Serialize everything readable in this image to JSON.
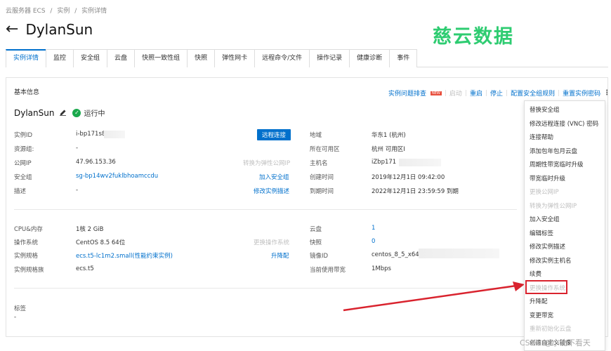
{
  "breadcrumb": [
    "云服务器 ECS",
    "/",
    "实例",
    "/",
    "实例详情"
  ],
  "header": {
    "back_icon": "←",
    "title": "DylanSun"
  },
  "watermark": "慈云数据",
  "tabs": [
    "实例详情",
    "监控",
    "安全组",
    "云盘",
    "快照一致性组",
    "快照",
    "弹性网卡",
    "远程命令/文件",
    "操作记录",
    "健康诊断",
    "事件"
  ],
  "section_title": "基本信息",
  "toolbar": {
    "diagnose": "实例问题排查",
    "new_badge": "NEW",
    "start": "启动",
    "restart": "重启",
    "stop": "停止",
    "security_rule": "配置安全组规则",
    "reset_password": "重置实例密码",
    "more": "⋮"
  },
  "instance": {
    "name": "DylanSun",
    "status": "运行中"
  },
  "info_left": [
    {
      "label": "实例ID",
      "value": "i-bp171s8",
      "action": "远程连接"
    },
    {
      "label": "资源组:",
      "value": "-",
      "action": ""
    },
    {
      "label": "公网IP",
      "value": "47.96.153.36",
      "action": "转换为弹性公网IP"
    },
    {
      "label": "安全组",
      "value": "sg-bp14wv2fuklbhoamccdu",
      "action": "加入安全组"
    },
    {
      "label": "描述",
      "value": "-",
      "action": "修改实例描述"
    }
  ],
  "info_right": [
    {
      "label": "地域",
      "value": "华东1 (杭州)"
    },
    {
      "label": "所在可用区",
      "value": "杭州 可用区I"
    },
    {
      "label": "主机名",
      "value": "iZbp171"
    },
    {
      "label": "创建时间",
      "value": "2019年12月1日 09:42:00"
    },
    {
      "label": "到期时间",
      "value": "2022年12月1日 23:59:59 到期"
    }
  ],
  "spec_left": [
    {
      "label": "CPU&内存",
      "value": "1核 2 GiB",
      "action": ""
    },
    {
      "label": "操作系统",
      "value": "CentOS 8.5 64位",
      "action": "更换操作系统"
    },
    {
      "label": "实例规格",
      "value": "ecs.t5-lc1m2.small(性能约束实例)",
      "action": "升降配"
    },
    {
      "label": "实例规格族",
      "value": "ecs.t5",
      "action": ""
    }
  ],
  "spec_right": [
    {
      "label": "云盘",
      "value": "1"
    },
    {
      "label": "快照",
      "value": "0"
    },
    {
      "label": "镜像ID",
      "value": "centos_8_5_x64_"
    },
    {
      "label": "当前使用带宽",
      "value": "1Mbps"
    }
  ],
  "tags": {
    "label": "标签",
    "value": "-"
  },
  "menu": [
    {
      "label": "替换安全组",
      "disabled": false
    },
    {
      "label": "修改远程连接 (VNC) 密码",
      "disabled": false
    },
    {
      "label": "连接帮助",
      "disabled": false
    },
    {
      "label": "添加包年包月云盘",
      "disabled": false
    },
    {
      "label": "周期性带宽临时升级",
      "disabled": false
    },
    {
      "label": "带宽临时升级",
      "disabled": false
    },
    {
      "label": "更换公网IP",
      "disabled": true
    },
    {
      "label": "转换为弹性公网IP",
      "disabled": true
    },
    {
      "label": "加入安全组",
      "disabled": false
    },
    {
      "label": "编辑标签",
      "disabled": false
    },
    {
      "label": "修改实例描述",
      "disabled": false
    },
    {
      "label": "修改实例主机名",
      "disabled": false
    },
    {
      "label": "续费",
      "disabled": false
    },
    {
      "label": "更换操作系统",
      "disabled": true
    },
    {
      "label": "升降配",
      "disabled": false
    },
    {
      "label": "变更带宽",
      "disabled": false
    },
    {
      "label": "重新初始化云盘",
      "disabled": true
    },
    {
      "label": "创建自定义镜像",
      "disabled": false
    }
  ],
  "footer_watermark": "CSDN @小沈不看天",
  "colors": {
    "accent": "#0070cc",
    "running": "#1aa94c",
    "watermark": "#2ecc71",
    "highlight": "#d9232e"
  }
}
